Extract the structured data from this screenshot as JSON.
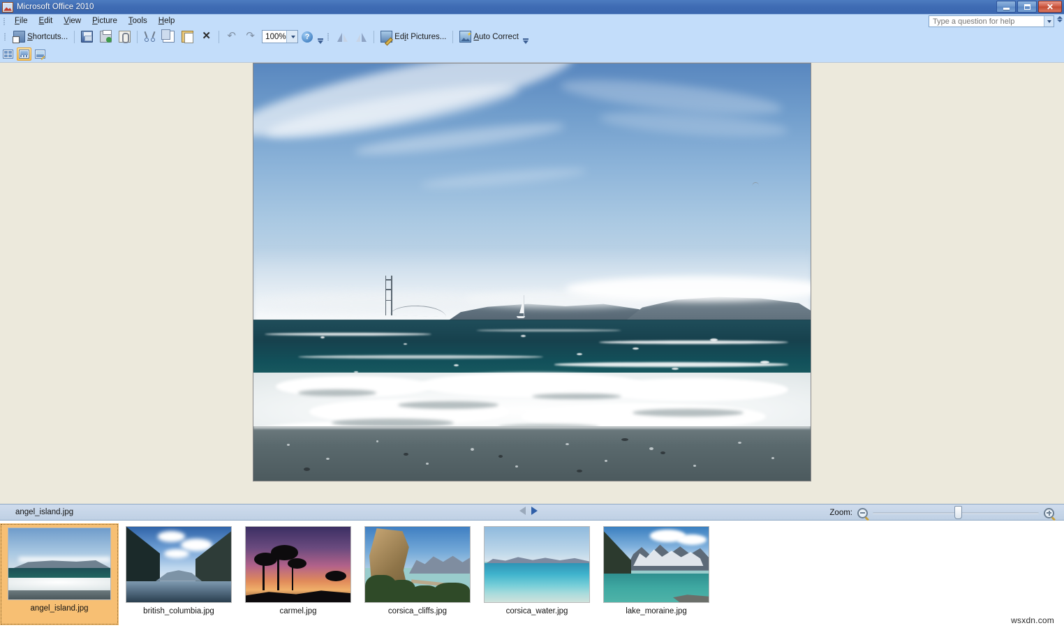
{
  "window": {
    "title": "Microsoft Office 2010",
    "app_icon": "picture-manager-icon",
    "minimize_label": "Minimize",
    "maximize_label": "Maximize",
    "close_label": "Close"
  },
  "menubar": {
    "items": [
      {
        "label": "File",
        "accel": "F"
      },
      {
        "label": "Edit",
        "accel": "E"
      },
      {
        "label": "View",
        "accel": "V"
      },
      {
        "label": "Picture",
        "accel": "P"
      },
      {
        "label": "Tools",
        "accel": "T"
      },
      {
        "label": "Help",
        "accel": "H"
      }
    ],
    "help_search": {
      "placeholder": "Type a question for help",
      "value": ""
    }
  },
  "toolbar": {
    "shortcuts_label": "Shortcuts...",
    "save_label": "Save",
    "print_label": "Print",
    "attach_label": "E-mail",
    "cut_label": "Cut",
    "copy_label": "Copy",
    "paste_label": "Paste",
    "delete_label": "Delete",
    "undo_label": "Undo",
    "redo_label": "Redo",
    "zoom_value": "100%",
    "help_label": "Microsoft Office Picture Manager Help",
    "rotate_left_label": "Rotate Left",
    "rotate_right_label": "Rotate Right",
    "edit_pictures_label": "Edit Pictures...",
    "auto_correct_label": "Auto Correct",
    "overflow_label": "Toolbar Options"
  },
  "view_toolbar": {
    "thumbnail_view_label": "Thumbnail View",
    "filmstrip_view_label": "Filmstrip View",
    "single_picture_view_label": "Single Picture View",
    "active_view": "filmstrip"
  },
  "statusbar": {
    "filename": "angel_island.jpg",
    "prev_label": "Previous Picture",
    "next_label": "Next Picture",
    "prev_enabled": false,
    "next_enabled": true,
    "zoom_label": "Zoom:",
    "zoom_out_label": "Zoom Out",
    "zoom_in_label": "Zoom In",
    "zoom_percent": 50
  },
  "filmstrip": {
    "thumbnails": [
      {
        "label": "angel_island.jpg",
        "selected": true,
        "art": "ti1"
      },
      {
        "label": "british_columbia.jpg",
        "selected": false,
        "art": "ti2"
      },
      {
        "label": "carmel.jpg",
        "selected": false,
        "art": "ti3"
      },
      {
        "label": "corsica_cliffs.jpg",
        "selected": false,
        "art": "ti4"
      },
      {
        "label": "corsica_water.jpg",
        "selected": false,
        "art": "ti5"
      },
      {
        "label": "lake_moraine.jpg",
        "selected": false,
        "art": "ti6"
      }
    ]
  },
  "preview": {
    "alt": "Angel Island - ocean surf on beach with Golden Gate Bridge tower, fog-covered headlands and a sailboat"
  },
  "watermark": {
    "text": "wsxdn.com"
  },
  "colors": {
    "titlebar_blue": "#3f6cb4",
    "menubar_blue": "#c3ddfa",
    "workspace_beige": "#ece9dc",
    "statusbar_blue": "#c6d5e8",
    "selection_orange": "#f7bf73",
    "filmstrip_white": "#ffffff"
  }
}
